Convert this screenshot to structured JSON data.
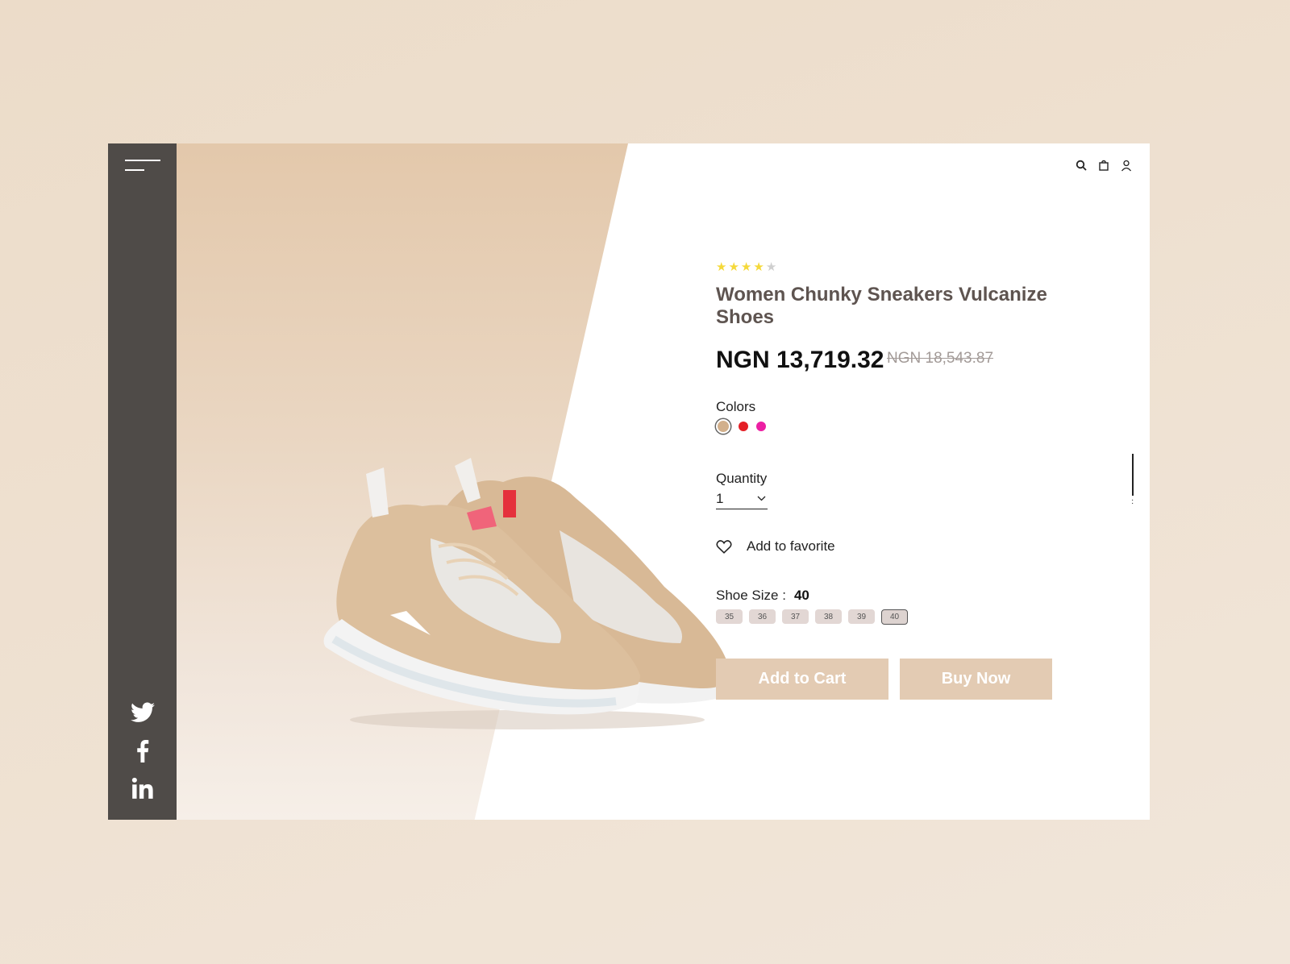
{
  "product": {
    "rating": 4,
    "rating_max": 5,
    "title": "Women Chunky Sneakers Vulcanize Shoes",
    "price_current": "NGN 13,719.32",
    "price_original": "NGN 18,543.87"
  },
  "colors": {
    "label": "Colors",
    "options": [
      "#d2b08c",
      "#e41f26",
      "#ec1fa3"
    ],
    "selected_index": 0
  },
  "quantity": {
    "label": "Quantity",
    "value": "1"
  },
  "favorite": {
    "label": "Add to favorite"
  },
  "shoe_size": {
    "label": "Shoe Size :",
    "selected": "40",
    "options": [
      "35",
      "36",
      "37",
      "38",
      "39",
      "40"
    ]
  },
  "actions": {
    "add_to_cart": "Add to Cart",
    "buy_now": "Buy Now"
  },
  "icons": {
    "menu": "menu-icon",
    "search": "search-icon",
    "bag": "shopping-bag-icon",
    "user": "user-icon",
    "twitter": "twitter-icon",
    "facebook": "facebook-icon",
    "linkedin": "linkedin-icon",
    "heart": "heart-icon"
  },
  "theme": {
    "accent": "#e3cbb3",
    "sidebar": "#4f4b48",
    "star_filled": "#f5d93a",
    "star_empty": "#cfcfcf"
  }
}
